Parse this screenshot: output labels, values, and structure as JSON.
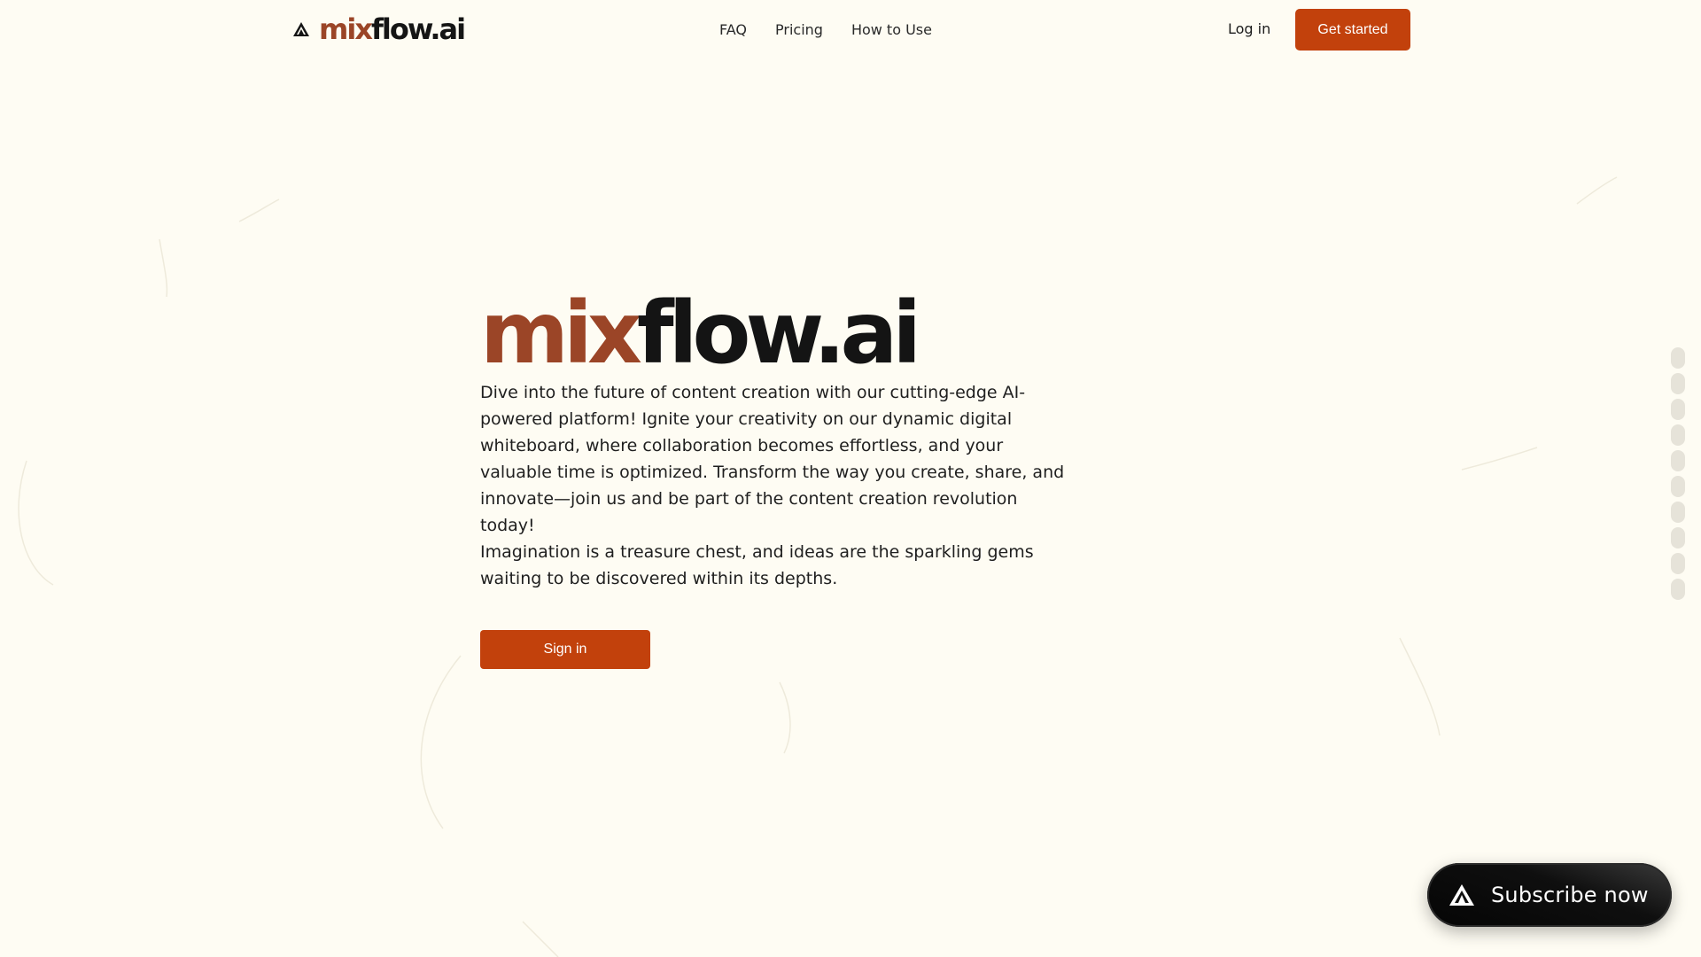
{
  "nav": {
    "brand": {
      "part1": "mix",
      "part2": "flow.ai"
    },
    "links": [
      "FAQ",
      "Pricing",
      "How to Use"
    ],
    "login_label": "Log in",
    "cta_label": "Get started"
  },
  "hero": {
    "title_part1": "mix",
    "title_part2": "flow.ai",
    "description": "Dive into the future of content creation with our cutting-edge AI-powered platform! Ignite your creativity on our dynamic digital whiteboard, where collaboration becomes effortless, and your valuable time is optimized. Transform the way you create, share, and innovate—join us and be part of the content creation revolution today!",
    "quote": "Imagination is a treasure chest, and ideas are the sparkling gems waiting to be discovered within its depths.",
    "signin_label": "Sign in"
  },
  "subscribe": {
    "label": "Subscribe now",
    "icon": "mixflow-logo-icon"
  },
  "colors": {
    "background": "#fefcf3",
    "accent": "#c2410c",
    "brand_rust": "#9b4527",
    "text_dark": "#141414"
  }
}
